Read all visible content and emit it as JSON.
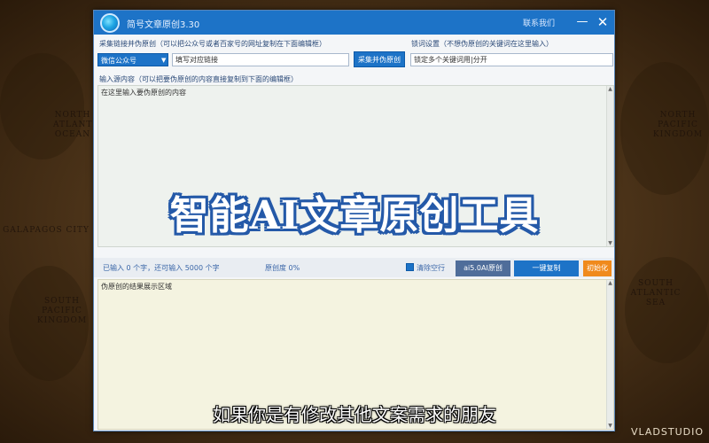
{
  "map": {
    "regions": [
      "NORTH ATLANTIC OCEAN",
      "NORTH PACIFIC KINGDOM",
      "GALAPAGOS CITY",
      "SOUTH PACIFIC KINGDOM",
      "SOUTH ATLANTIC SEA"
    ],
    "watermark": "VLADSTUDIO"
  },
  "window": {
    "title": "简号文章原创3.30",
    "contact_label": "联系我们",
    "min_icon": "—",
    "close_icon": "✕",
    "collect_label": "采集链接并伪原创（可以把公众号或者百家号的网址复制在下面编辑框）",
    "platform_selected": "微信公众号",
    "url_placeholder": "填写对应链接",
    "collect_button": "采集并伪原创",
    "lock_label": "锁词设置（不想伪原创的关键词在这里输入）",
    "lock_value": "锁定多个关键词用|分开",
    "source_label": "输入源内容（可以把要伪原创的内容直接复制到下面的编辑框）",
    "source_placeholder": "在这里输入要伪原创的内容",
    "status_text": "已输入 0 个字，还可输入 5000 个字",
    "rate_text": "原创度 0%",
    "clear_blank_label": "清除空行",
    "ai_button": "ai5.0AI原创",
    "copy_button": "一键复制",
    "init_button": "初始化",
    "result_placeholder": "伪原创的结果展示区域"
  },
  "overlay": {
    "banner": "智能AI文章原创工具",
    "subtitle": "如果你是有修改其他文案需求的朋友"
  },
  "colors": {
    "titlebar": "#1d73c7",
    "accent_orange": "#f08a1c",
    "banner_outline": "#2459a8"
  }
}
